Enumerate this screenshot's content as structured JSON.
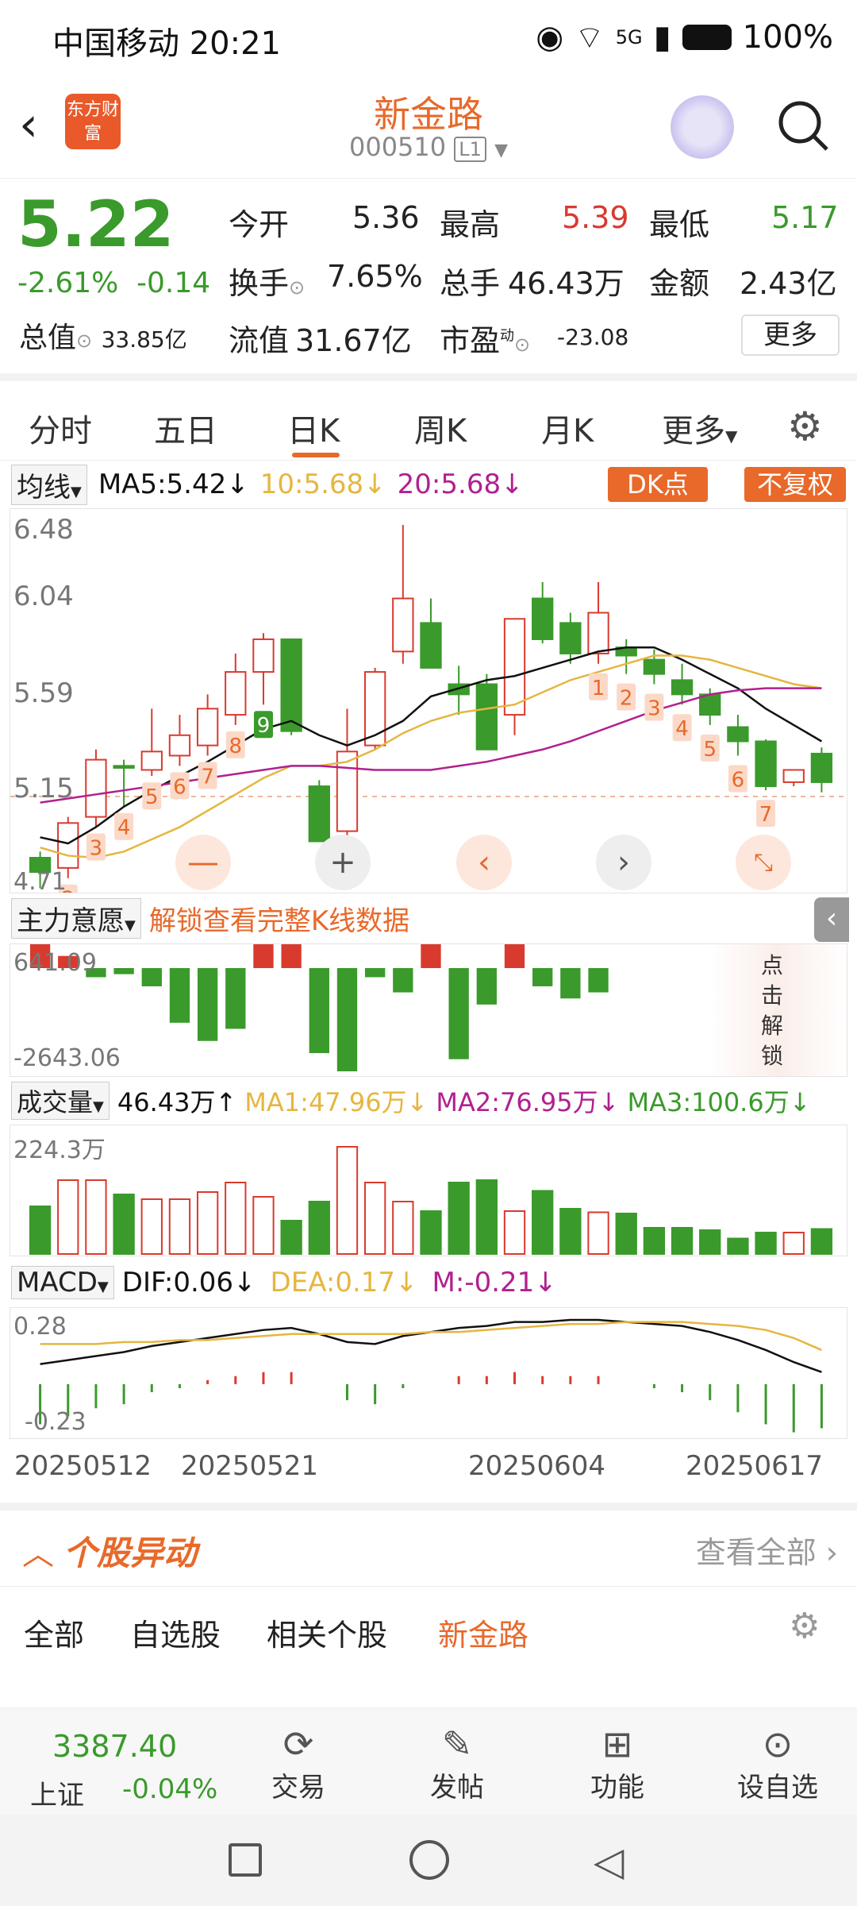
{
  "status": {
    "carrier": "中国移动",
    "time": "20:21",
    "network": "5G",
    "battery": "100%"
  },
  "header": {
    "title": "新金路",
    "code": "000510",
    "level": "L1",
    "brand": "东方财富"
  },
  "quote": {
    "price": "5.22",
    "pct": "-2.61%",
    "chg": "-0.14",
    "open_label": "今开",
    "open": "5.36",
    "high_label": "最高",
    "high": "5.39",
    "low_label": "最低",
    "low": "5.17",
    "turnover_label": "换手",
    "turnover": "7.65%",
    "volume_label": "总手",
    "volume": "46.43万",
    "amount_label": "金额",
    "amount": "2.43亿",
    "mcap_label": "总值",
    "mcap": "33.85亿",
    "float_label": "流值",
    "float": "31.67亿",
    "pe_label": "市盈",
    "pe_sup": "动",
    "pe": "-23.08",
    "more": "更多"
  },
  "tabs": [
    "分时",
    "五日",
    "日K",
    "周K",
    "月K",
    "更多"
  ],
  "active_tab": "日K",
  "ma_bar": {
    "selector": "均线",
    "ma5": "MA5:5.42",
    "ma10": "10:5.68",
    "ma20": "20:5.68",
    "dk": "DK点",
    "fq": "不复权"
  },
  "price_axis": [
    "6.48",
    "6.04",
    "5.59",
    "5.15",
    "4.71"
  ],
  "chart_data": {
    "type": "candlestick",
    "ohlc": [
      [
        4.85,
        4.88,
        4.7,
        4.78
      ],
      [
        4.8,
        5.05,
        4.75,
        5.02
      ],
      [
        5.05,
        5.38,
        5.0,
        5.33
      ],
      [
        5.3,
        5.33,
        5.1,
        5.29
      ],
      [
        5.28,
        5.58,
        5.25,
        5.37
      ],
      [
        5.35,
        5.55,
        5.3,
        5.45
      ],
      [
        5.4,
        5.65,
        5.35,
        5.58
      ],
      [
        5.55,
        5.85,
        5.5,
        5.76
      ],
      [
        5.76,
        5.95,
        5.6,
        5.92
      ],
      [
        5.92,
        5.92,
        5.45,
        5.47
      ],
      [
        5.2,
        5.23,
        4.93,
        4.93
      ],
      [
        4.98,
        5.58,
        4.94,
        5.37
      ],
      [
        5.4,
        5.78,
        5.38,
        5.76
      ],
      [
        5.86,
        6.48,
        5.8,
        6.12
      ],
      [
        6.0,
        6.12,
        5.8,
        5.78
      ],
      [
        5.7,
        5.79,
        5.55,
        5.65
      ],
      [
        5.7,
        5.75,
        5.38,
        5.38
      ],
      [
        5.55,
        6.02,
        5.45,
        6.02
      ],
      [
        6.12,
        6.2,
        5.9,
        5.92
      ],
      [
        6.0,
        6.05,
        5.8,
        5.85
      ],
      [
        5.85,
        6.2,
        5.8,
        6.05
      ],
      [
        5.88,
        5.92,
        5.75,
        5.84
      ],
      [
        5.82,
        5.87,
        5.7,
        5.75
      ],
      [
        5.72,
        5.8,
        5.6,
        5.65
      ],
      [
        5.65,
        5.68,
        5.5,
        5.55
      ],
      [
        5.49,
        5.55,
        5.35,
        5.42
      ],
      [
        5.42,
        5.43,
        5.18,
        5.2
      ],
      [
        5.22,
        5.28,
        5.2,
        5.28
      ],
      [
        5.36,
        5.39,
        5.17,
        5.22
      ]
    ],
    "ma5": [
      4.95,
      4.92,
      5.0,
      5.1,
      5.18,
      5.25,
      5.32,
      5.4,
      5.48,
      5.52,
      5.45,
      5.4,
      5.45,
      5.52,
      5.64,
      5.68,
      5.72,
      5.74,
      5.78,
      5.82,
      5.86,
      5.88,
      5.88,
      5.82,
      5.75,
      5.68,
      5.58,
      5.5,
      5.42
    ],
    "ma10": [
      4.9,
      4.86,
      4.85,
      4.88,
      4.94,
      5.0,
      5.08,
      5.16,
      5.24,
      5.3,
      5.3,
      5.32,
      5.38,
      5.46,
      5.52,
      5.56,
      5.58,
      5.6,
      5.66,
      5.72,
      5.76,
      5.8,
      5.84,
      5.84,
      5.82,
      5.78,
      5.74,
      5.7,
      5.68
    ],
    "ma20": [
      5.12,
      5.14,
      5.16,
      5.18,
      5.2,
      5.22,
      5.24,
      5.26,
      5.28,
      5.3,
      5.3,
      5.29,
      5.28,
      5.28,
      5.28,
      5.3,
      5.32,
      5.35,
      5.38,
      5.42,
      5.47,
      5.52,
      5.57,
      5.61,
      5.65,
      5.67,
      5.68,
      5.68,
      5.68
    ],
    "ref_price": 5.15,
    "y_min": 4.71,
    "y_max": 6.48,
    "dates": [
      "20250512",
      "20250521",
      "20250604",
      "20250617"
    ],
    "markers": [
      {
        "i": 1,
        "t": "2",
        "c": "red"
      },
      {
        "i": 2,
        "t": "3",
        "c": "red"
      },
      {
        "i": 3,
        "t": "4",
        "c": "red"
      },
      {
        "i": 4,
        "t": "5",
        "c": "red"
      },
      {
        "i": 5,
        "t": "6",
        "c": "red"
      },
      {
        "i": 6,
        "t": "7",
        "c": "red"
      },
      {
        "i": 7,
        "t": "8",
        "c": "red"
      },
      {
        "i": 8,
        "t": "9",
        "c": "green"
      },
      {
        "i": 20,
        "t": "1",
        "c": "red"
      },
      {
        "i": 21,
        "t": "2",
        "c": "red"
      },
      {
        "i": 22,
        "t": "3",
        "c": "red"
      },
      {
        "i": 23,
        "t": "4",
        "c": "red"
      },
      {
        "i": 24,
        "t": "5",
        "c": "red"
      },
      {
        "i": 25,
        "t": "6",
        "c": "red"
      },
      {
        "i": 26,
        "t": "7",
        "c": "red"
      }
    ],
    "main_force": [
      120,
      40,
      -30,
      -20,
      -60,
      -180,
      -240,
      -200,
      250,
      150,
      -280,
      -340,
      -30,
      -80,
      200,
      -300,
      -120,
      160,
      -60,
      -100,
      -80
    ],
    "mf_axis": [
      "641.09",
      "-2643.06"
    ],
    "volume": [
      40,
      62,
      62,
      50,
      46,
      46,
      52,
      60,
      48,
      28,
      44,
      90,
      60,
      44,
      36,
      60,
      62,
      36,
      53,
      38,
      35,
      34,
      22,
      22,
      20,
      13,
      18,
      18,
      21
    ],
    "vol_axis": [
      "224.3万"
    ],
    "dif": [
      0.1,
      0.12,
      0.14,
      0.16,
      0.19,
      0.21,
      0.23,
      0.25,
      0.27,
      0.28,
      0.25,
      0.21,
      0.2,
      0.24,
      0.26,
      0.28,
      0.29,
      0.31,
      0.31,
      0.32,
      0.32,
      0.31,
      0.3,
      0.29,
      0.26,
      0.22,
      0.17,
      0.11,
      0.06
    ],
    "dea": [
      0.2,
      0.2,
      0.2,
      0.21,
      0.21,
      0.22,
      0.22,
      0.23,
      0.24,
      0.25,
      0.25,
      0.25,
      0.25,
      0.25,
      0.26,
      0.26,
      0.27,
      0.28,
      0.29,
      0.3,
      0.3,
      0.31,
      0.31,
      0.31,
      0.3,
      0.29,
      0.27,
      0.23,
      0.17
    ],
    "macd_axis": [
      "0.28",
      "-0.23"
    ]
  },
  "mf_bar": {
    "selector": "主力意愿",
    "unlock": "解锁查看完整K线数据",
    "side_unlock": "点击解锁"
  },
  "vol_bar": {
    "selector": "成交量",
    "vol": "46.43万↑",
    "ma1": "MA1:47.96万↓",
    "ma2": "MA2:76.95万↓",
    "ma3": "MA3:100.6万↓"
  },
  "macd_bar": {
    "selector": "MACD",
    "dif": "DIF:0.06↓",
    "dea": "DEA:0.17↓",
    "m": "M:-0.21↓"
  },
  "anomaly": {
    "title": "个股异动",
    "view_all": "查看全部"
  },
  "filters": [
    "全部",
    "自选股",
    "相关个股",
    "新金路"
  ],
  "active_filter": "新金路",
  "nav": {
    "index_value": "3387.40",
    "index_name": "上证",
    "index_pct": "-0.04%",
    "items": [
      "交易",
      "发帖",
      "功能",
      "设自选"
    ]
  }
}
